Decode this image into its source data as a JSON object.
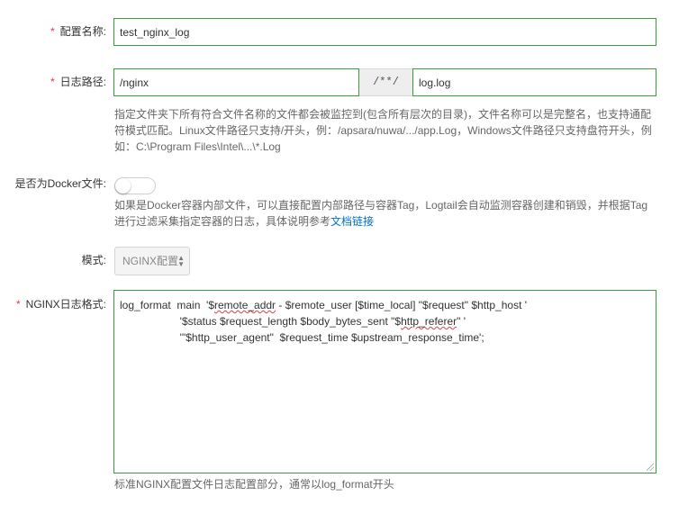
{
  "config_name": {
    "label": "配置名称:",
    "value": "test_nginx_log"
  },
  "log_path": {
    "label": "日志路径:",
    "dir_value": "/nginx",
    "separator": "/**/",
    "file_value": "log.log",
    "help_line1": "指定文件夹下所有符合文件名称的文件都会被监控到(包含所有层次的目录)，文件名称可以是完整名，也支持通配",
    "help_line2": "符模式匹配。Linux文件路径只支持/开头，例：/apsara/nuwa/.../app.Log，Windows文件路径只支持盘符开头，例",
    "help_line3": "如：C:\\Program Files\\Intel\\...\\*.Log"
  },
  "docker": {
    "label": "是否为Docker文件:",
    "enabled": false,
    "help_line1": "如果是Docker容器内部文件，可以直接配置内部路径与容器Tag，Logtail会自动监测容器创建和销毁，并根据Tag",
    "help_line2_prefix": "进行过滤采集指定容器的日志，具体说明参考",
    "help_link": "文档链接"
  },
  "mode": {
    "label": "模式:",
    "selected": "NGINX配置"
  },
  "nginx_format": {
    "label": "NGINX日志格式:",
    "line1_a": "log_format  main  '$",
    "line1_b": "remote_addr",
    "line1_c": " - $remote_user [$time_local] \"$request\" $http_host '",
    "line2_a": "                    '$status $request_length $body_bytes_sent \"$",
    "line2_b": "http_referer",
    "line2_c": "\" '",
    "line3": "                    '\"$http_user_agent\"  $request_time $upstream_response_time';",
    "help": "标准NGINX配置文件日志配置部分，通常以log_format开头"
  },
  "colors": {
    "required": "#e4393c",
    "input_border": "#3c9a3c",
    "link": "#0070cc"
  }
}
